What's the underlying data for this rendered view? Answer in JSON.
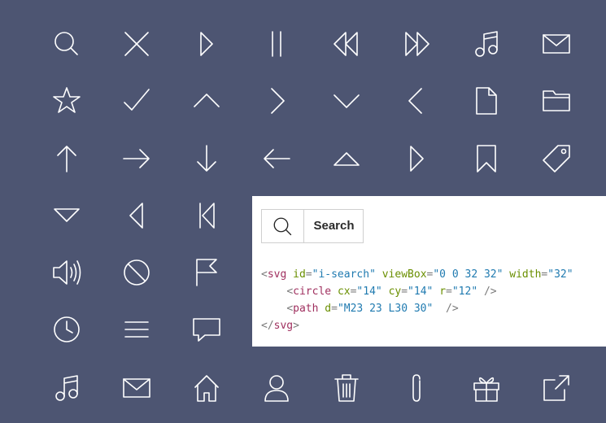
{
  "background_color": "#4d5572",
  "icon_color": "#ffffff",
  "icon_grid": [
    [
      "search-icon",
      "close-icon",
      "play-icon",
      "pause-icon",
      "rewind-icon",
      "fast-forward-icon",
      "music-note-icon",
      "mail-icon"
    ],
    [
      "star-icon",
      "checkmark-icon",
      "chevron-up-icon",
      "chevron-right-icon",
      "chevron-down-icon",
      "chevron-left-icon",
      "document-icon",
      "folder-icon"
    ],
    [
      "arrow-up-icon",
      "arrow-right-icon",
      "arrow-down-icon",
      "arrow-left-icon",
      "triangle-up-icon",
      "triangle-right-icon",
      "bookmark-icon",
      "tag-icon"
    ],
    [
      "triangle-down-icon",
      "triangle-left-icon",
      "skip-back-icon"
    ],
    [
      "volume-icon",
      "ban-icon",
      "flag-icon"
    ],
    [
      "clock-icon",
      "menu-icon",
      "chat-icon"
    ],
    [
      "music-note-icon",
      "mail-icon",
      "home-icon",
      "user-icon",
      "trash-icon",
      "paperclip-icon",
      "gift-icon",
      "external-link-icon"
    ]
  ],
  "demo": {
    "button_label": "Search",
    "button_icon": "search-icon",
    "code": {
      "line1": {
        "tag": "svg",
        "id_attr": "id",
        "id_val": "\"i-search\"",
        "vb_attr": "viewBox",
        "vb_val": "\"0 0 32 32\"",
        "w_attr": "width",
        "w_val": "\"32\""
      },
      "line2": {
        "tag": "circle",
        "cx_attr": "cx",
        "cx_val": "\"14\"",
        "cy_attr": "cy",
        "cy_val": "\"14\"",
        "r_attr": "r",
        "r_val": "\"12\""
      },
      "line3": {
        "tag": "path",
        "d_attr": "d",
        "d_val": "\"M23 23 L30 30\""
      },
      "line4": {
        "tag": "svg"
      }
    }
  }
}
